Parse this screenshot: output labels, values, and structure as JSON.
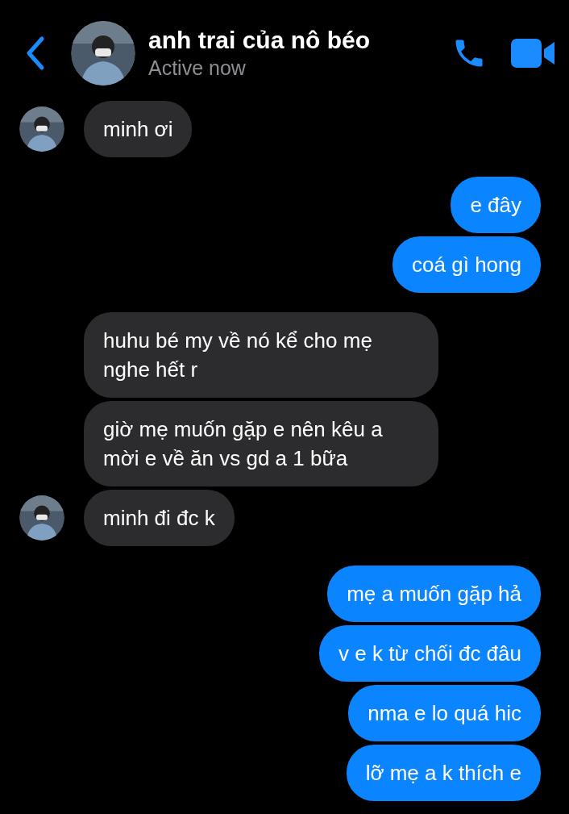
{
  "header": {
    "name": "anh trai của nô béo",
    "status": "Active now"
  },
  "groups": [
    {
      "kind": "incoming",
      "messages": [
        {
          "text": "minh ơi",
          "show_avatar": true
        }
      ]
    },
    {
      "kind": "outgoing",
      "messages": [
        {
          "text": "e đây",
          "show_avatar": false
        },
        {
          "text": "coá gì hong",
          "show_avatar": false
        }
      ]
    },
    {
      "kind": "incoming",
      "messages": [
        {
          "text": "huhu bé my về nó kể cho mẹ nghe hết r",
          "show_avatar": false
        },
        {
          "text": "giờ mẹ muốn gặp e nên kêu a mời e về ăn vs gd a 1 bữa",
          "show_avatar": false
        },
        {
          "text": "minh đi đc k",
          "show_avatar": true
        }
      ]
    },
    {
      "kind": "outgoing",
      "messages": [
        {
          "text": "mẹ a muốn gặp hả",
          "show_avatar": false
        },
        {
          "text": "v e k từ chối đc đâu",
          "show_avatar": false
        },
        {
          "text": "nma e lo quá hic",
          "show_avatar": false
        },
        {
          "text": "lỡ mẹ a k thích e",
          "show_avatar": false
        }
      ]
    }
  ]
}
